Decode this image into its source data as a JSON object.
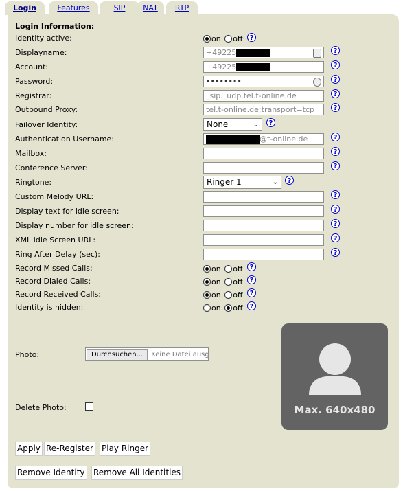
{
  "tabs": [
    {
      "label": "Login"
    },
    {
      "label": "Features"
    },
    {
      "label": "SIP"
    },
    {
      "label": "NAT"
    },
    {
      "label": "RTP"
    }
  ],
  "section_heading": "Login Information:",
  "labels": {
    "identity_active": "Identity active:",
    "displayname": "Displayname:",
    "account": "Account:",
    "password": "Password:",
    "registrar": "Registrar:",
    "outbound_proxy": "Outbound Proxy:",
    "failover_identity": "Failover Identity:",
    "auth_username": "Authentication Username:",
    "mailbox": "Mailbox:",
    "conference_server": "Conference Server:",
    "ringtone": "Ringtone:",
    "custom_melody_url": "Custom Melody URL:",
    "idle_text": "Display text for idle screen:",
    "idle_number": "Display number for idle screen:",
    "xml_idle_url": "XML Idle Screen URL:",
    "ring_after_delay": "Ring After Delay (sec):",
    "record_missed": "Record Missed Calls:",
    "record_dialed": "Record Dialed Calls:",
    "record_received": "Record Received Calls:",
    "identity_hidden": "Identity is hidden:",
    "photo": "Photo:",
    "delete_photo": "Delete Photo:"
  },
  "radio_text": {
    "on": "on",
    "off": "off"
  },
  "radio_state": {
    "identity_active": "on",
    "record_missed": "on",
    "record_dialed": "on",
    "record_received": "on",
    "identity_hidden": "off"
  },
  "values": {
    "displayname_prefix": "+49225",
    "account_prefix": "+49225",
    "password_mask": "••••••••",
    "registrar": "_sip._udp.tel.t-online.de",
    "outbound_proxy": "tel.t-online.de;transport=tcp",
    "auth_username_suffix": "@t-online.de",
    "mailbox": "",
    "conference_server": "",
    "custom_melody_url": "",
    "idle_text": "",
    "idle_number": "",
    "xml_idle_url": "",
    "ring_after_delay": ""
  },
  "selects": {
    "failover_identity": "None",
    "ringtone": "Ringer 1"
  },
  "help_glyph": "?",
  "file_input": {
    "button": "Durchsuchen...",
    "status": "Keine Datei ausgewählt."
  },
  "photo_placeholder": "Max. 640x480",
  "buttons": {
    "apply": "Apply",
    "re_register": "Re-Register",
    "play_ringer": "Play Ringer",
    "remove_identity": "Remove Identity",
    "remove_all_identities": "Remove All Identities"
  },
  "icons": {
    "help": "help-icon",
    "contact_card": "contact-card-icon",
    "password_key": "password-key-icon",
    "chevron": "chevron-down-icon",
    "avatar": "avatar-silhouette-icon"
  },
  "colors": {
    "panel": "#e3e3d0",
    "link": "#0000cc",
    "photo_bg": "#636363"
  }
}
